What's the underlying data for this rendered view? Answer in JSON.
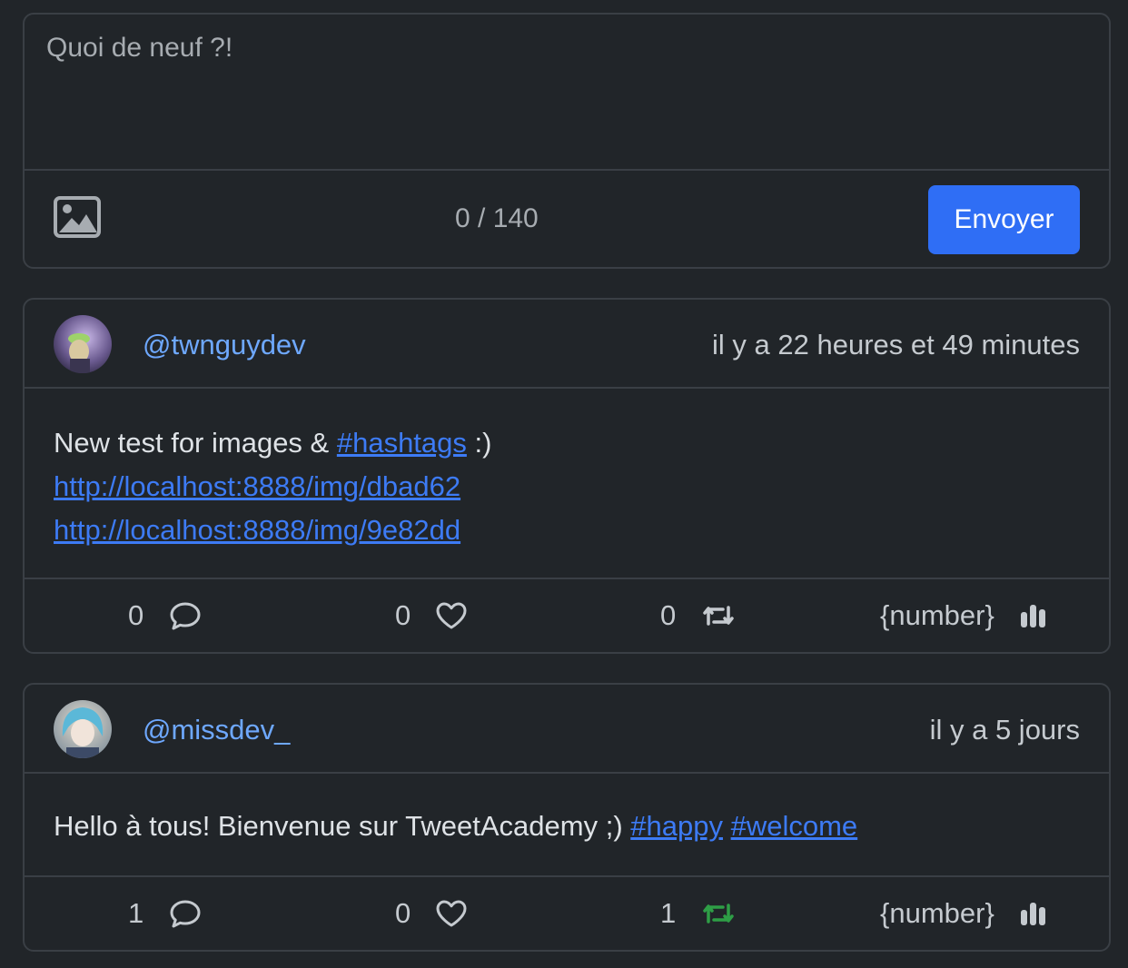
{
  "composer": {
    "placeholder": "Quoi de neuf ?!",
    "counter": "0 / 140",
    "send_label": "Envoyer",
    "image_icon": "image-icon"
  },
  "tweets": [
    {
      "handle": "@twnguydev",
      "time": "il y a 22 heures et 49 minutes",
      "text_before": "New test for images & ",
      "hashtag1": "#hashtags",
      "text_after": " :)",
      "link1": "http://localhost:8888/img/dbad62",
      "link2": "http://localhost:8888/img/9e82dd",
      "replies": "0",
      "likes": "0",
      "retweets": "0",
      "views": "{number}",
      "retweet_active": false
    },
    {
      "handle": "@missdev_",
      "time": "il y a 5 jours",
      "text_before": "Hello à tous! Bienvenue sur TweetAcademy ;) ",
      "hashtag1": "#happy",
      "hashtag2": "#welcome",
      "replies": "1",
      "likes": "0",
      "retweets": "1",
      "views": "{number}",
      "retweet_active": true
    }
  ],
  "colors": {
    "background": "#212529",
    "accent": "#2f6ef5",
    "link": "#3d7bf5",
    "handle": "#6ea8fe",
    "retweet_active": "#2e9e46"
  }
}
